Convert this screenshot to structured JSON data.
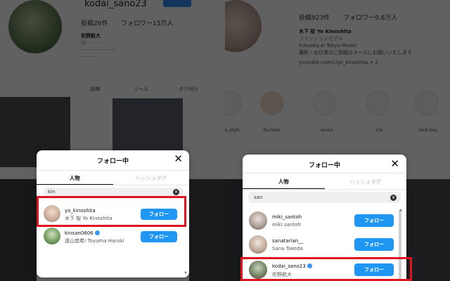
{
  "left_profile": {
    "username": "kodai_sano23",
    "posts": "投稿26件",
    "followers": "フォロワー15万人",
    "name": "佐野航大",
    "bio_line1": "@",
    "bio_line2": "",
    "bio_line3": "",
    "tab_posts": "投稿",
    "tab_reels": "リール",
    "tab_tagged": "タグ付け"
  },
  "right_profile": {
    "posts": "投稿923件",
    "followers": "フォロワー9.8万人",
    "name": "木下 桜 Yo Kinoshita",
    "bio_line1": "ファッションモデル",
    "bio_line2": "Fukuoka ⇄ Tokyo Model",
    "bio_line3": "撮影・お仕事のご依頼はメールにお願いいたします",
    "bio_line4": "youtube.com/c/yo_kinoshita + 2",
    "highlights": [
      "yo_style",
      "YouTube",
      "works",
      "sns",
      "best buy"
    ]
  },
  "left_modal": {
    "title": "フォロー中",
    "close": "✕",
    "tab_people": "人物",
    "tab_hashtags": "ハッシュタグ",
    "search_value": "kin",
    "rows": [
      {
        "username": "yo_kinoshita",
        "fullname": "木下 桜 Yo Kinoshita",
        "button": "フォロー",
        "verified": false
      },
      {
        "username": "kinsan0606",
        "fullname": "遠山悠希/ Toyama Haruki",
        "button": "フォロー",
        "verified": true
      }
    ]
  },
  "right_modal": {
    "title": "フォロー中",
    "close": "✕",
    "tab_people": "人物",
    "tab_hashtags": "ハッシュタグ",
    "search_value": "san",
    "rows": [
      {
        "username": "miki_santoh",
        "fullname": "miki santoh",
        "button": "フォロー",
        "verified": false
      },
      {
        "username": "sanatarian__",
        "fullname": "Sana Takeda",
        "button": "フォロー",
        "verified": false
      },
      {
        "username": "kodai_sano23",
        "fullname": "佐野航大",
        "button": "フォロー",
        "verified": true
      }
    ]
  },
  "colors": {
    "accent": "#1f96f2",
    "highlight": "#e0141e",
    "verified": "#3897f0"
  }
}
